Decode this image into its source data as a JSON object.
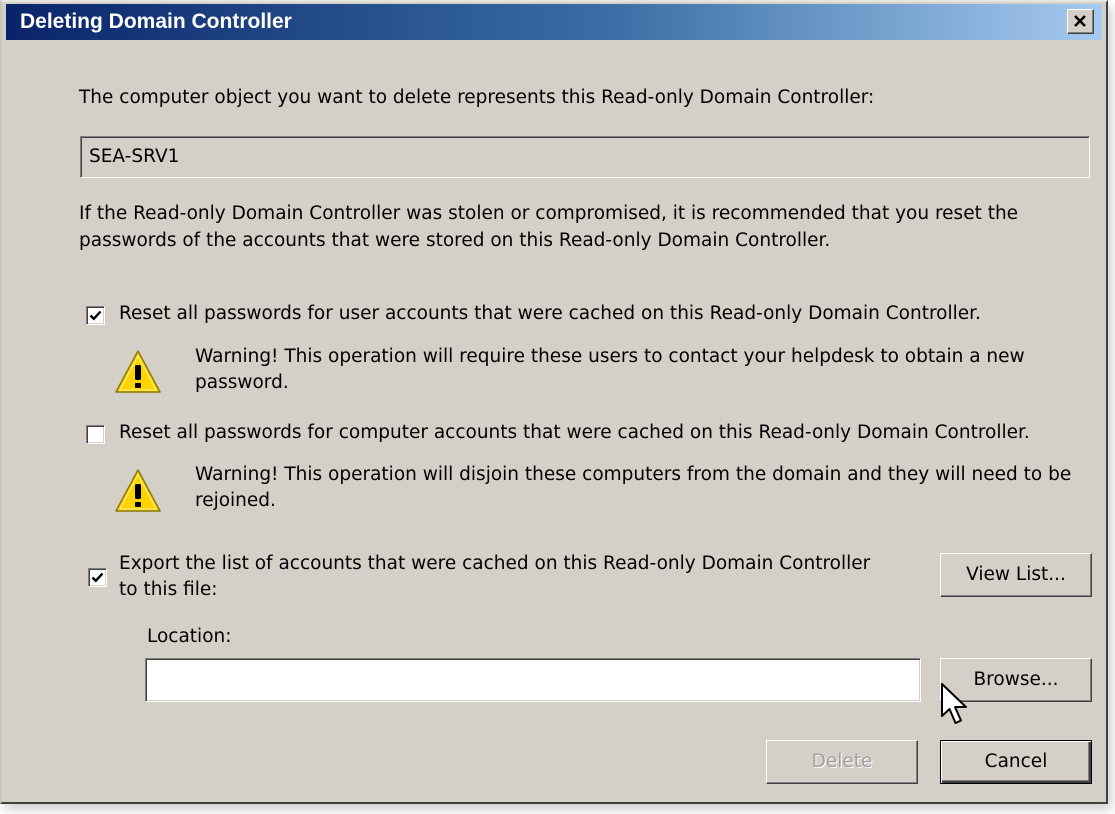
{
  "window": {
    "title": "Deleting Domain Controller",
    "close_label": "×"
  },
  "intro_text": "The computer object you want to delete represents this Read-only Domain Controller:",
  "dc_name": "SEA-SRV1",
  "info_text": {
    "line1": "If the Read-only Domain Controller was stolen or compromised, it is recommended that you reset the",
    "line2": "passwords of the accounts that were stored on this Read-only Domain Controller."
  },
  "options": {
    "reset_users": {
      "label": "Reset all passwords for user accounts that were cached on this Read-only Domain Controller.",
      "checked": true,
      "warning_line1": "Warning! This operation will require these users to contact your helpdesk to obtain a new",
      "warning_line2": "password."
    },
    "reset_computers": {
      "label": "Reset all passwords for computer accounts that were cached on this Read-only Domain Controller.",
      "checked": false,
      "warning_line1": "Warning! This operation will disjoin these computers from the domain and they will need to be",
      "warning_line2": "rejoined."
    },
    "export": {
      "label_line1": "Export the list of accounts that were cached on this Read-only Domain Controller",
      "label_line2": "to this file:",
      "checked": true
    }
  },
  "location": {
    "label": "Location:",
    "value": ""
  },
  "buttons": {
    "view_list": "View List...",
    "browse": "Browse...",
    "delete": "Delete",
    "cancel": "Cancel"
  },
  "icons": {
    "warning": "warning-triangle-icon",
    "cursor": "mouse-pointer-icon"
  },
  "colors": {
    "dialog_bg": "#d4d0c8",
    "title_start": "#0a246a",
    "title_end": "#a6caf0",
    "warning_yellow": "#ffd200"
  }
}
